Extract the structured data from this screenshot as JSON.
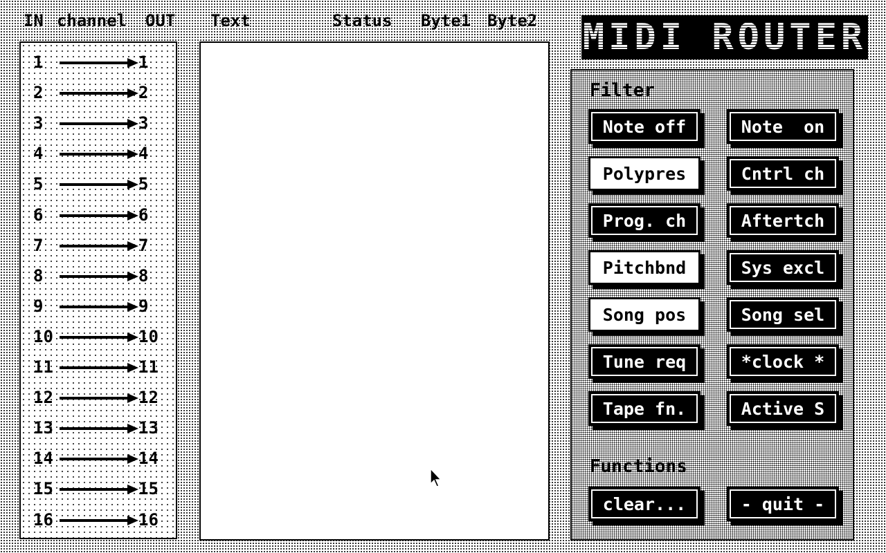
{
  "header": {
    "col_in": "IN",
    "col_channel": "channel",
    "col_out": "OUT",
    "col_text": "Text",
    "col_status": "Status",
    "col_byte1": "Byte1",
    "col_byte2": "Byte2"
  },
  "app_title": "MIDI ROUTER",
  "channels": [
    {
      "in": "1",
      "out": "1"
    },
    {
      "in": "2",
      "out": "2"
    },
    {
      "in": "3",
      "out": "3"
    },
    {
      "in": "4",
      "out": "4"
    },
    {
      "in": "5",
      "out": "5"
    },
    {
      "in": "6",
      "out": "6"
    },
    {
      "in": "7",
      "out": "7"
    },
    {
      "in": "8",
      "out": "8"
    },
    {
      "in": "9",
      "out": "9"
    },
    {
      "in": "10",
      "out": "10"
    },
    {
      "in": "11",
      "out": "11"
    },
    {
      "in": "12",
      "out": "12"
    },
    {
      "in": "13",
      "out": "13"
    },
    {
      "in": "14",
      "out": "14"
    },
    {
      "in": "15",
      "out": "15"
    },
    {
      "in": "16",
      "out": "16"
    }
  ],
  "filter": {
    "title": "Filter",
    "buttons": [
      {
        "label": "Note off",
        "active": true
      },
      {
        "label": "Note  on",
        "active": true
      },
      {
        "label": "Polypres",
        "active": false
      },
      {
        "label": "Cntrl ch",
        "active": true
      },
      {
        "label": "Prog. ch",
        "active": true
      },
      {
        "label": "Aftertch",
        "active": true
      },
      {
        "label": "Pitchbnd",
        "active": false
      },
      {
        "label": "Sys excl",
        "active": true
      },
      {
        "label": "Song pos",
        "active": false
      },
      {
        "label": "Song sel",
        "active": true
      },
      {
        "label": "Tune req",
        "active": true
      },
      {
        "label": "*clock *",
        "active": true
      },
      {
        "label": "Tape fn.",
        "active": true
      },
      {
        "label": "Active S",
        "active": true
      }
    ]
  },
  "functions": {
    "title": "Functions",
    "clear_label": "clear...",
    "quit_label": "- quit -"
  }
}
